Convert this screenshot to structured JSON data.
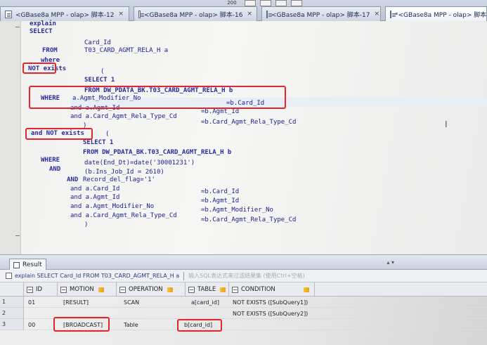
{
  "toolbar": {
    "zoom": "200"
  },
  "tabs": [
    {
      "label": "<GBase8a MPP - olap> 脚本-12",
      "close": "×"
    },
    {
      "label": "<GBase8a MPP - olap> 脚本-16",
      "close": "×"
    },
    {
      "label": "<GBase8a MPP - olap> 脚本-17",
      "close": "×"
    },
    {
      "label": "*<GBase8a MPP - olap> 脚本",
      "close": ""
    }
  ],
  "code_lines": [
    "explain",
    "SELECT",
    "Card_Id",
    "FROM",
    "T03_CARD_AGMT_RELA_H a",
    "where",
    "NOT exists",
    "(",
    "SELECT 1",
    "FROM DW_PDATA_BK.T03_CARD_AGMT_RELA_H b",
    "WHERE",
    "a.Agmt_Modifier_No",
    "=b.Card_Id",
    "and a.Agmt_Id",
    "=b.Agmt_Id",
    "and a.Card_Agmt_Rela_Type_Cd",
    "=b.Card_Agmt_Rela_Type_Cd",
    ")",
    "and NOT exists",
    "(",
    "SELECT 1",
    "FROM DW_PDATA_BK.T03_CARD_AGMT_RELA_H b",
    "WHERE",
    "date(End_Dt)=date('30001231')",
    "AND",
    "(b.Ins_Job_Id = 2610)",
    "AND",
    "Record_del_flag='1'",
    "and a.Card_Id",
    "=b.Card_Id",
    "and a.Agmt_Id",
    "=b.Agmt_Id",
    "and a.Agmt_Modifier_No",
    "=b.Agmt_Modifier_No",
    "and a.Card_Agmt_Rela_Type_Cd",
    "=b.Card_Agmt_Rela_Type_Cd",
    ")"
  ],
  "result": {
    "tab_label": "Result",
    "sql_text": "explain SELECT Card_Id FROM T03_CARD_AGMT_RELA_H a",
    "filter_hint": "输入SQL表达式来过滤结果集 (使用Ctrl+空格)",
    "columns": [
      "ID",
      "MOTION",
      "OPERATION",
      "TABLE",
      "CONDITION"
    ],
    "rows": [
      {
        "num": "1",
        "id": "01",
        "motion": "[RESULT]",
        "operation": "SCAN",
        "table": "a[card_id]",
        "condition": "NOT EXISTS ([SubQuery1])"
      },
      {
        "num": "2",
        "id": "",
        "motion": "",
        "operation": "",
        "table": "",
        "condition": "NOT EXISTS ([SubQuery2])"
      },
      {
        "num": "3",
        "id": "00",
        "motion": "[BROADCAST]",
        "operation": "Table",
        "table": "b[card_id]",
        "condition": ""
      }
    ]
  },
  "colors": {
    "highlight_box": "#e3262b",
    "code_text": "#1d1d8a",
    "sql_text": "#2a3b83"
  }
}
